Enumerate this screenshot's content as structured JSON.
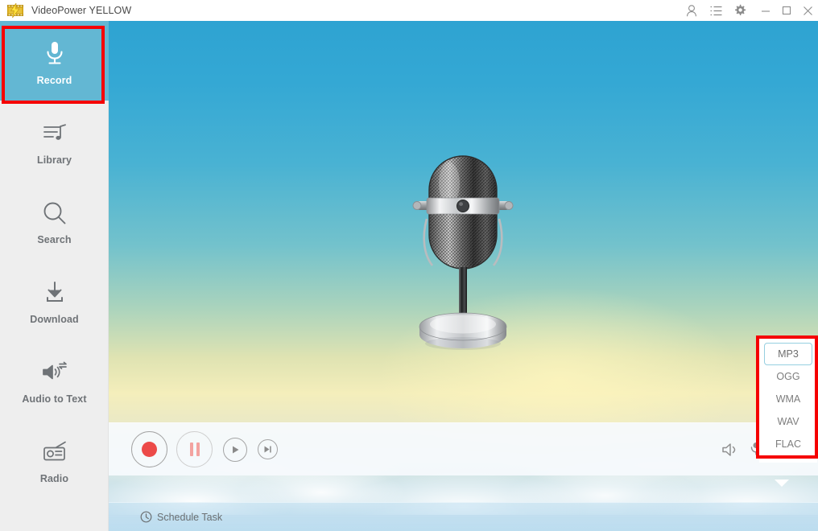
{
  "window": {
    "title": "VideoPower YELLOW",
    "logo_icon": "videopower-logo-icon",
    "actions": [
      {
        "name": "account-icon",
        "glyph": "user"
      },
      {
        "name": "list-icon",
        "glyph": "list"
      },
      {
        "name": "settings-gear-icon",
        "glyph": "gear"
      },
      {
        "name": "minimize-button",
        "glyph": "minimize"
      },
      {
        "name": "maximize-button",
        "glyph": "maximize"
      },
      {
        "name": "close-button",
        "glyph": "close"
      }
    ]
  },
  "sidebar": {
    "items": [
      {
        "label": "Record",
        "icon": "microphone-icon",
        "active": true
      },
      {
        "label": "Library",
        "icon": "music-list-icon",
        "active": false
      },
      {
        "label": "Search",
        "icon": "search-icon",
        "active": false
      },
      {
        "label": "Download",
        "icon": "download-icon",
        "active": false
      },
      {
        "label": "Audio to Text",
        "icon": "audio-to-text-icon",
        "active": false
      },
      {
        "label": "Radio",
        "icon": "radio-icon",
        "active": false
      }
    ]
  },
  "stage": {
    "artwork": "retro-microphone-illustration"
  },
  "format_menu": {
    "selected": "MP3",
    "options": [
      {
        "label": "MP3",
        "selected": true
      },
      {
        "label": "OGG",
        "selected": false
      },
      {
        "label": "WMA",
        "selected": false
      },
      {
        "label": "WAV",
        "selected": false
      },
      {
        "label": "FLAC",
        "selected": false
      }
    ]
  },
  "toolbar": {
    "transport": [
      {
        "name": "record-button",
        "state": "enabled"
      },
      {
        "name": "pause-button",
        "state": "disabled"
      },
      {
        "name": "play-button",
        "state": "enabled"
      },
      {
        "name": "next-button",
        "state": "enabled"
      }
    ],
    "right_icons": [
      {
        "name": "system-sound-icon",
        "active": false
      },
      {
        "name": "microphone-input-icon",
        "active": false
      },
      {
        "name": "output-format-icon",
        "active": true
      }
    ]
  },
  "statusbar": {
    "schedule_task_label": "Schedule Task",
    "schedule_task_icon": "clock-icon"
  },
  "highlights": {
    "record_nav": "#f50000",
    "format_menu": "#f50000"
  },
  "colors": {
    "accent_teal": "#63b7d3",
    "sidebar_bg": "#eeeeee",
    "record_red": "#ec4a48",
    "selected_border": "#96cfe0"
  }
}
